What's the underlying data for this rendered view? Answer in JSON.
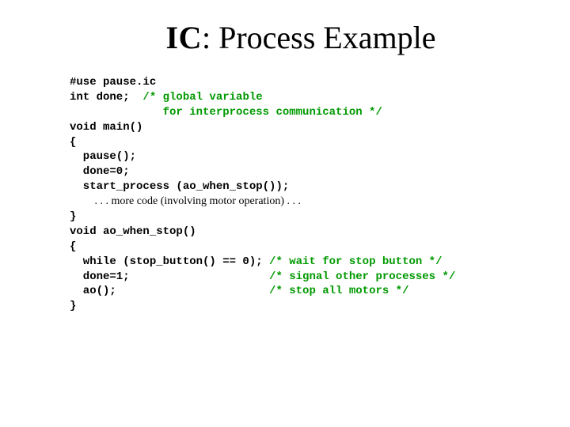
{
  "title": {
    "ic": "IC",
    "rest": ": Process Example"
  },
  "code": {
    "l1": "#use pause.ic",
    "l2a": "int done;  ",
    "l2b": "/* global variable",
    "l3b": "              for interprocess communication */",
    "l4": "void main()",
    "l5": "{",
    "l6": "  pause();",
    "l7": "  done=0;",
    "l8": "  start_process (ao_when_stop());",
    "l9_note": "         . . . more code (involving motor operation) . . .",
    "l10": "}",
    "l11": "void ao_when_stop()",
    "l12": "{",
    "l13a": "  while (stop_button() == 0); ",
    "l13b": "/* wait for stop button */",
    "l14a": "  done=1;                     ",
    "l14b": "/* signal other processes */",
    "l15a": "  ao();                       ",
    "l15b": "/* stop all motors */",
    "l16": "}"
  }
}
